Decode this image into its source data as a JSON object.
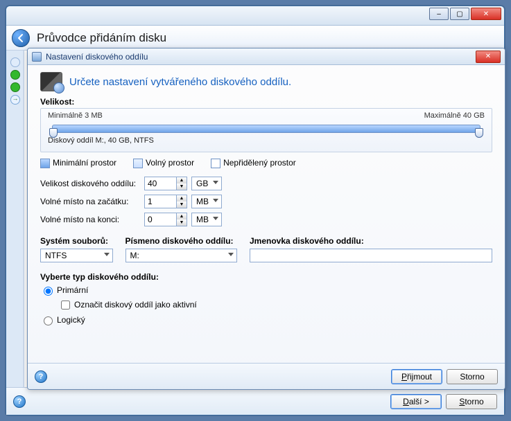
{
  "outer": {
    "title": "Průvodce přidáním disku",
    "buttons": {
      "minimize": "–",
      "maximize": "▢",
      "close": "✕"
    },
    "footer": {
      "next": "Další >",
      "next_ul": "D",
      "cancel": "Storno",
      "cancel_ul": "S"
    }
  },
  "dialog": {
    "title": "Nastavení diskového oddílu",
    "heading": "Určete nastavení vytvářeného diskového oddílu.",
    "size_section": "Velikost:",
    "slider": {
      "min_label": "Minimálně 3 MB",
      "max_label": "Maximálně 40 GB",
      "caption": "Diskový oddíl M:, 40 GB, NTFS"
    },
    "legend": {
      "min_space": "Minimální prostor",
      "free_space": "Volný prostor",
      "unalloc": "Nepřidělený prostor"
    },
    "fields": {
      "part_size_label": "Velikost diskového oddílu:",
      "part_size_value": "40",
      "part_size_unit": "GB",
      "free_before_label": "Volné místo na začátku:",
      "free_before_value": "1",
      "free_before_unit": "MB",
      "free_after_label": "Volné místo na konci:",
      "free_after_value": "0",
      "free_after_unit": "MB"
    },
    "fs": {
      "fs_label": "Systém souborů:",
      "fs_value": "NTFS",
      "letter_label": "Písmeno diskového oddílu:",
      "letter_value": "M:",
      "volname_label": "Jmenovka diskového oddílu:",
      "volname_value": ""
    },
    "type_section": "Vyberte typ diskového oddílu:",
    "types": {
      "primary": "Primární",
      "active": "Označit diskový oddíl jako aktivní",
      "logical": "Logický"
    },
    "footer": {
      "accept": "Přijmout",
      "accept_ul": "P",
      "cancel": "Storno"
    }
  }
}
